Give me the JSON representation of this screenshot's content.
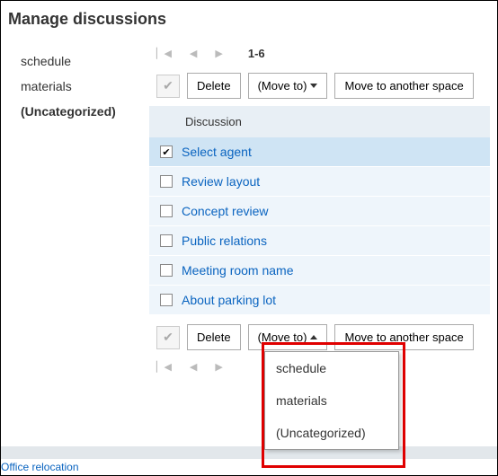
{
  "header": {
    "title": "Manage discussions"
  },
  "sidebar": {
    "items": [
      {
        "label": "schedule",
        "active": false
      },
      {
        "label": "materials",
        "active": false
      },
      {
        "label": "(Uncategorized)",
        "active": true
      }
    ]
  },
  "pager": {
    "range": "1-6"
  },
  "toolbar": {
    "delete": "Delete",
    "moveto": "(Move to)",
    "move_space": "Move to another space"
  },
  "table": {
    "header": "Discussion",
    "rows": [
      {
        "label": "Select agent",
        "checked": true
      },
      {
        "label": "Review layout",
        "checked": false
      },
      {
        "label": "Concept review",
        "checked": false
      },
      {
        "label": "Public relations",
        "checked": false
      },
      {
        "label": "Meeting room name",
        "checked": false
      },
      {
        "label": "About parking lot",
        "checked": false
      }
    ]
  },
  "dropdown": {
    "items": [
      {
        "label": "schedule"
      },
      {
        "label": "materials"
      },
      {
        "label": "(Uncategorized)"
      }
    ]
  },
  "footer": {
    "link": "Office relocation"
  }
}
